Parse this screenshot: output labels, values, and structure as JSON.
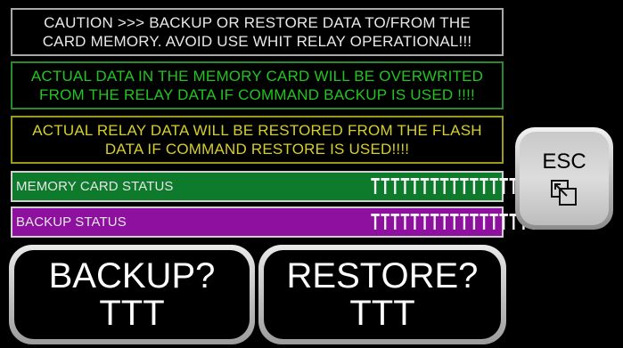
{
  "messages": {
    "caution": [
      "CAUTION >>> BACKUP OR RESTORE DATA TO/FROM THE",
      "CARD MEMORY. AVOID USE WHIT RELAY OPERATIONAL!!!"
    ],
    "overwrite": [
      "ACTUAL DATA IN THE MEMORY CARD WILL BE OVERWRITED",
      "FROM THE RELAY DATA IF COMMAND BACKUP IS USED !!!!"
    ],
    "restore": [
      "ACTUAL RELAY DATA WILL BE RESTORED FROM THE FLASH",
      "DATA IF COMMAND RESTORE IS USED!!!!"
    ]
  },
  "status": {
    "memory_card_label": "MEMORY CARD STATUS",
    "memory_card_value": "TTTTTTTTTTTTTTTTTTTT",
    "backup_label": "BACKUP STATUS",
    "backup_value": "TTTTTTTTTTTTTTTTTTTT"
  },
  "buttons": {
    "backup_label": "BACKUP?",
    "backup_value": "TTT",
    "restore_label": "RESTORE?",
    "restore_value": "TTT",
    "esc_label": "ESC"
  },
  "icons": {
    "esc": "window-restore-icon"
  },
  "colors": {
    "caution_text": "#e8e8e8",
    "overwrite_text": "#22c422",
    "restore_text": "#d6cf2a",
    "memory_card_bg": "#0d7a2c",
    "backup_bg": "#8d109f"
  }
}
